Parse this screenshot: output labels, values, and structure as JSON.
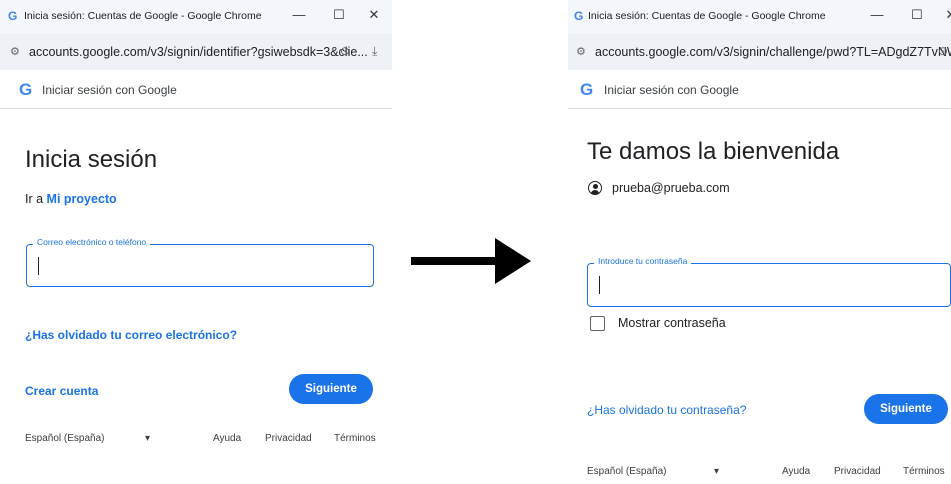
{
  "left": {
    "window_title": "Inicia sesión: Cuentas de Google - Google Chrome",
    "url": "accounts.google.com/v3/signin/identifier?gsiwebsdk=3&clie...",
    "header_label": "Iniciar sesión con Google",
    "heading": "Inicia sesión",
    "sub_prefix": "Ir a ",
    "sub_link": "Mi proyecto",
    "field_label": "Correo electrónico o teléfono",
    "forgot_link": "¿Has olvidado tu correo electrónico?",
    "create_account": "Crear cuenta",
    "next_button": "Siguiente",
    "language": "Español (España)",
    "help": "Ayuda",
    "privacy": "Privacidad",
    "terms": "Términos"
  },
  "right": {
    "window_title": "Inicia sesión: Cuentas de Google - Google Chrome",
    "url": "accounts.google.com/v3/signin/challenge/pwd?TL=ADgdZ7TvNW...",
    "header_label": "Iniciar sesión con Google",
    "heading": "Te damos la bienvenida",
    "email": "prueba@prueba.com",
    "field_label": "Introduce tu contraseña",
    "show_password": "Mostrar contraseña",
    "forgot_link": "¿Has olvidado tu contraseña?",
    "next_button": "Siguiente",
    "language": "Español (España)",
    "help": "Ayuda",
    "privacy": "Privacidad",
    "terms": "Términos"
  },
  "icons": {
    "google_logo": "G",
    "minimize": "—",
    "maximize": "☐",
    "close": "✕",
    "site_settings": "⚙",
    "password_key": "⊙",
    "download": "⤓",
    "dropdown": "▾"
  },
  "colors": {
    "accent": "#1a73e8",
    "google_blue": "#4285f4"
  }
}
